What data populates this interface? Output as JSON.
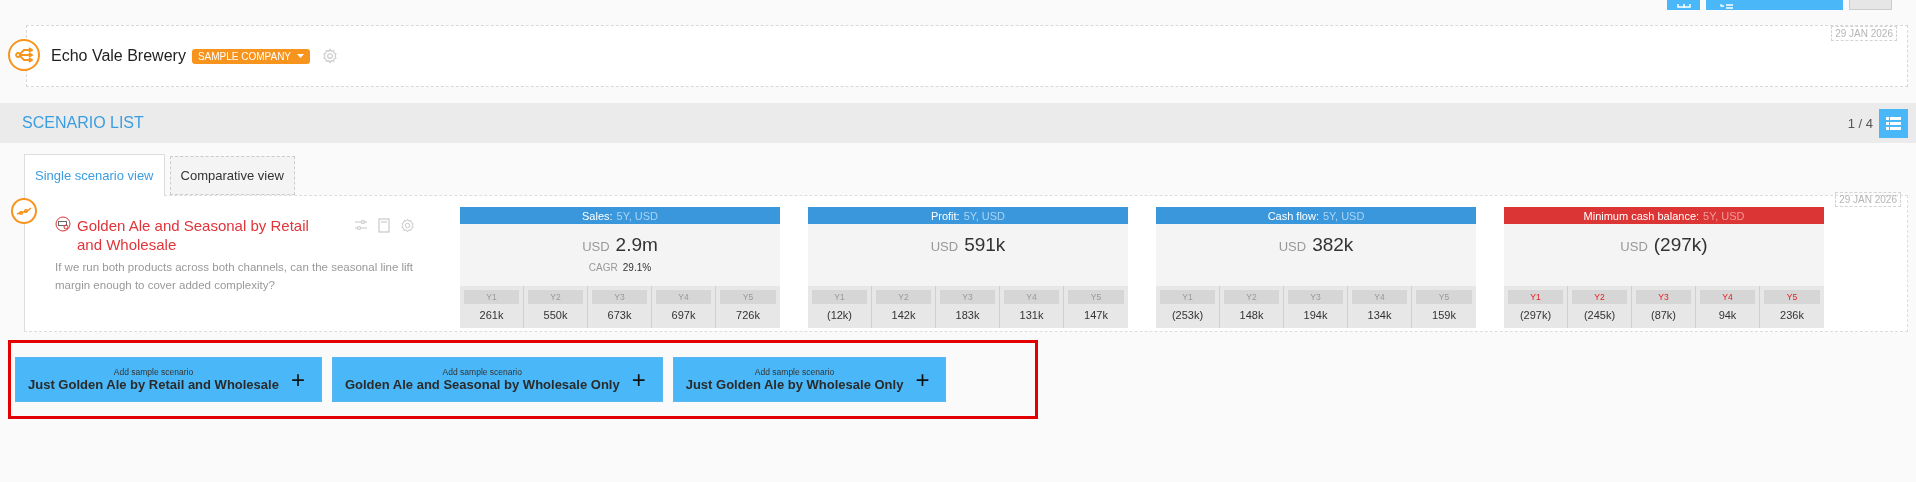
{
  "company": {
    "name": "Echo Vale Brewery",
    "badge": "SAMPLE COMPANY",
    "date": "29 JAN 2026"
  },
  "scenario_list": {
    "title": "SCENARIO LIST",
    "pager": "1 / 4"
  },
  "tabs": [
    {
      "label": "Single scenario view",
      "selected": true
    },
    {
      "label": "Comparative view",
      "selected": false
    }
  ],
  "scenario": {
    "title": "Golden Ale and Seasonal by Retail and Wholesale",
    "description": "If we run both products across both channels, can the seasonal line lift margin enough to cover added complexity?",
    "date": "29 JAN 2026",
    "metrics": [
      {
        "label": "Sales:",
        "period": "5Y, USD",
        "alert": false,
        "currency": "USD",
        "total": "2.9m",
        "cagr_label": "CAGR",
        "cagr": "29.1%",
        "years": [
          {
            "label": "Y1",
            "value": "261k"
          },
          {
            "label": "Y2",
            "value": "550k"
          },
          {
            "label": "Y3",
            "value": "673k"
          },
          {
            "label": "Y4",
            "value": "697k"
          },
          {
            "label": "Y5",
            "value": "726k"
          }
        ]
      },
      {
        "label": "Profit:",
        "period": "5Y, USD",
        "alert": false,
        "currency": "USD",
        "total": "591k",
        "years": [
          {
            "label": "Y1",
            "value": "(12k)"
          },
          {
            "label": "Y2",
            "value": "142k"
          },
          {
            "label": "Y3",
            "value": "183k"
          },
          {
            "label": "Y4",
            "value": "131k"
          },
          {
            "label": "Y5",
            "value": "147k"
          }
        ]
      },
      {
        "label": "Cash flow:",
        "period": "5Y, USD",
        "alert": false,
        "currency": "USD",
        "total": "382k",
        "years": [
          {
            "label": "Y1",
            "value": "(253k)"
          },
          {
            "label": "Y2",
            "value": "148k"
          },
          {
            "label": "Y3",
            "value": "194k"
          },
          {
            "label": "Y4",
            "value": "134k"
          },
          {
            "label": "Y5",
            "value": "159k"
          }
        ]
      },
      {
        "label": "Minimum cash balance:",
        "period": "5Y, USD",
        "alert": true,
        "currency": "USD",
        "total": "(297k)",
        "years": [
          {
            "label": "Y1",
            "value": "(297k)"
          },
          {
            "label": "Y2",
            "value": "(245k)"
          },
          {
            "label": "Y3",
            "value": "(87k)"
          },
          {
            "label": "Y4",
            "value": "94k"
          },
          {
            "label": "Y5",
            "value": "236k"
          }
        ]
      }
    ]
  },
  "sample_buttons": [
    {
      "caption": "Add sample scenario",
      "label": "Just Golden Ale by Retail and Wholesale",
      "icon": "+"
    },
    {
      "caption": "Add sample scenario",
      "label": "Golden Ale and Seasonal by Wholesale Only",
      "icon": "+"
    },
    {
      "caption": "Add sample scenario",
      "label": "Just Golden Ale by Wholesale Only",
      "icon": "+"
    }
  ]
}
